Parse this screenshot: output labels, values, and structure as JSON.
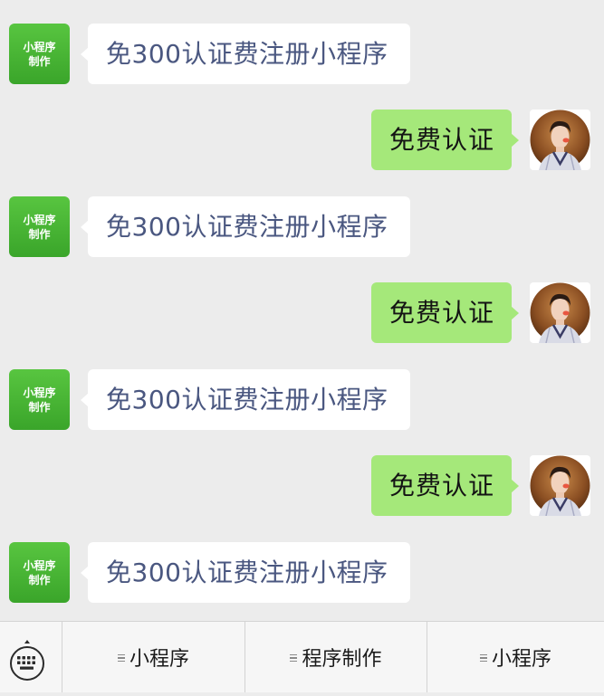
{
  "chat": {
    "messages": [
      {
        "side": "left",
        "avatar_line1": "小程序",
        "avatar_line2": "制作",
        "text": "免300认证费注册小程序"
      },
      {
        "side": "right",
        "avatar": "person-photo",
        "text": "免费认证"
      },
      {
        "side": "left",
        "avatar_line1": "小程序",
        "avatar_line2": "制作",
        "text": "免300认证费注册小程序"
      },
      {
        "side": "right",
        "avatar": "person-photo",
        "text": "免费认证"
      },
      {
        "side": "left",
        "avatar_line1": "小程序",
        "avatar_line2": "制作",
        "text": "免300认证费注册小程序"
      },
      {
        "side": "right",
        "avatar": "person-photo",
        "text": "免费认证"
      },
      {
        "side": "left",
        "avatar_line1": "小程序",
        "avatar_line2": "制作",
        "text": "免300认证费注册小程序"
      }
    ]
  },
  "bottom_bar": {
    "keyboard_icon": "keyboard-icon",
    "menu": [
      {
        "label": "小程序"
      },
      {
        "label": "程序制作"
      },
      {
        "label": "小程序"
      }
    ]
  },
  "colors": {
    "background": "#ececec",
    "incoming_bubble": "#ffffff",
    "incoming_text": "#4a5780",
    "outgoing_bubble": "#a5e87a",
    "brand_avatar": "#4cb834"
  }
}
